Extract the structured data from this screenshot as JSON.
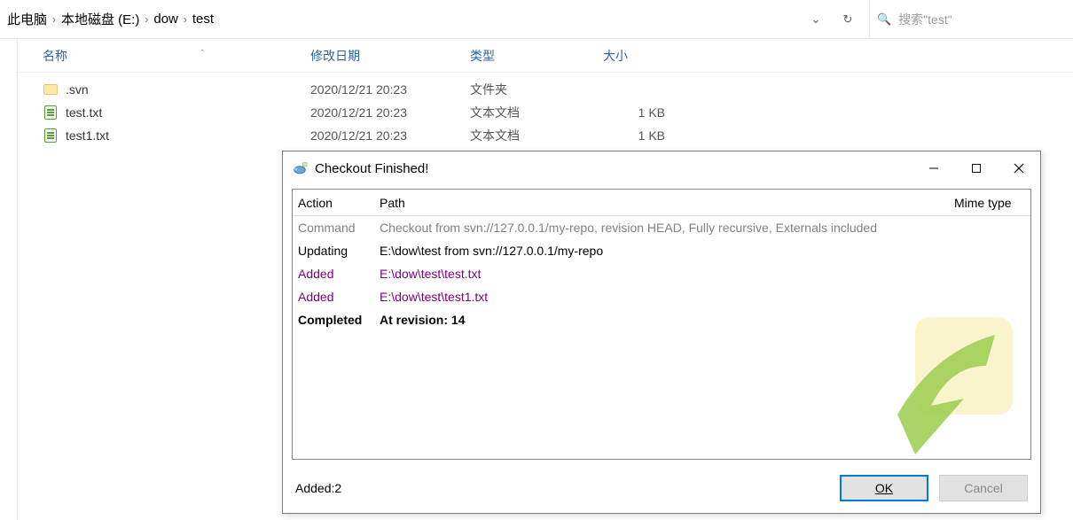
{
  "breadcrumb": {
    "items": [
      {
        "label": "此电脑"
      },
      {
        "label": "本地磁盘 (E:)"
      },
      {
        "label": "dow"
      },
      {
        "label": "test"
      }
    ]
  },
  "search": {
    "placeholder": "搜索\"test\""
  },
  "columns": {
    "name": "名称",
    "date": "修改日期",
    "type": "类型",
    "size": "大小"
  },
  "files": [
    {
      "icon": "folder",
      "name": ".svn",
      "date": "2020/12/21 20:23",
      "type": "文件夹",
      "size": ""
    },
    {
      "icon": "textfile",
      "name": "test.txt",
      "date": "2020/12/21 20:23",
      "type": "文本文档",
      "size": "1 KB"
    },
    {
      "icon": "textfile",
      "name": "test1.txt",
      "date": "2020/12/21 20:23",
      "type": "文本文档",
      "size": "1 KB"
    }
  ],
  "dialog": {
    "title": "Checkout Finished!",
    "headers": {
      "action": "Action",
      "path": "Path",
      "mime": "Mime type"
    },
    "rows": [
      {
        "style": "gray",
        "action": "Command",
        "path": "Checkout from svn://127.0.0.1/my-repo, revision HEAD, Fully recursive, Externals included"
      },
      {
        "style": "",
        "action": "Updating",
        "path": "E:\\dow\\test from svn://127.0.0.1/my-repo"
      },
      {
        "style": "purple",
        "action": "Added",
        "path": "E:\\dow\\test\\test.txt"
      },
      {
        "style": "purple",
        "action": "Added",
        "path": "E:\\dow\\test\\test1.txt"
      },
      {
        "style": "bold",
        "action": "Completed",
        "path": "At revision: 14"
      }
    ],
    "status": "Added:2",
    "buttons": {
      "ok": "OK",
      "cancel": "Cancel"
    }
  }
}
